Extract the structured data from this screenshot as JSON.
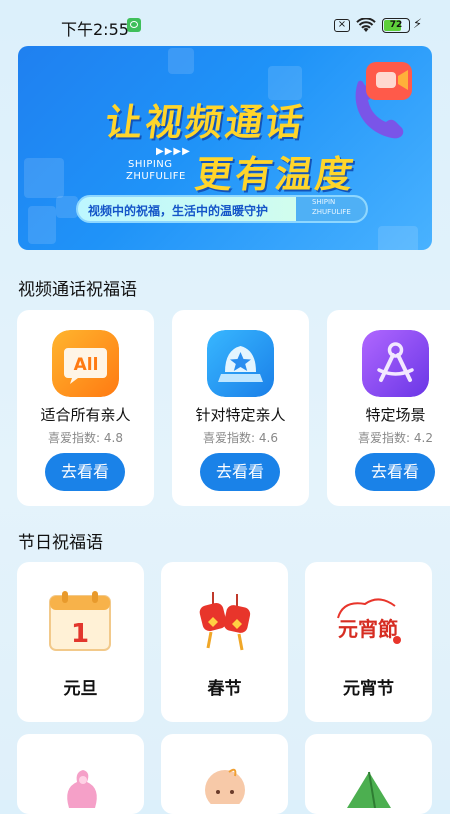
{
  "status_bar": {
    "time": "下午2:55",
    "battery": "72",
    "battery_level": 0.72
  },
  "banner": {
    "title_line1": "让视频通话",
    "title_line2": "更有温度",
    "play_marks": "▶▶▶▶",
    "en_line1": "SHIPING",
    "en_line2": "ZHUFULIFE",
    "tagline": "视频中的祝福，生活中的温暖守护",
    "en_small1": "SHIPIN",
    "en_small2": "ZHUFULIFE"
  },
  "section_video": {
    "title": "视频通话祝福语",
    "cards": [
      {
        "name": "适合所有亲人",
        "score": "喜爱指数: 4.8",
        "button": "去看看",
        "icon": "all-chat-icon",
        "icon_text": "All"
      },
      {
        "name": "针对特定亲人",
        "score": "喜爱指数: 4.6",
        "button": "去看看",
        "icon": "star-badge-icon"
      },
      {
        "name": "特定场景",
        "score": "喜爱指数: 4.2",
        "button": "去看看",
        "icon": "compass-tool-icon"
      }
    ]
  },
  "section_festival": {
    "title": "节日祝福语",
    "cards": [
      {
        "name": "元旦",
        "icon": "calendar-icon",
        "icon_text": "1"
      },
      {
        "name": "春节",
        "icon": "red-lanterns-icon"
      },
      {
        "name": "元宵节",
        "icon": "yuanxiao-stamp-icon",
        "icon_text": "元宵節"
      }
    ],
    "next_row_icons": [
      "sachet-icon",
      "baby-icon",
      "zongzi-icon"
    ]
  },
  "colors": {
    "accent": "#1a82e8",
    "title_yellow": "#ffd52b",
    "banner_blue": "#1f88f4"
  }
}
